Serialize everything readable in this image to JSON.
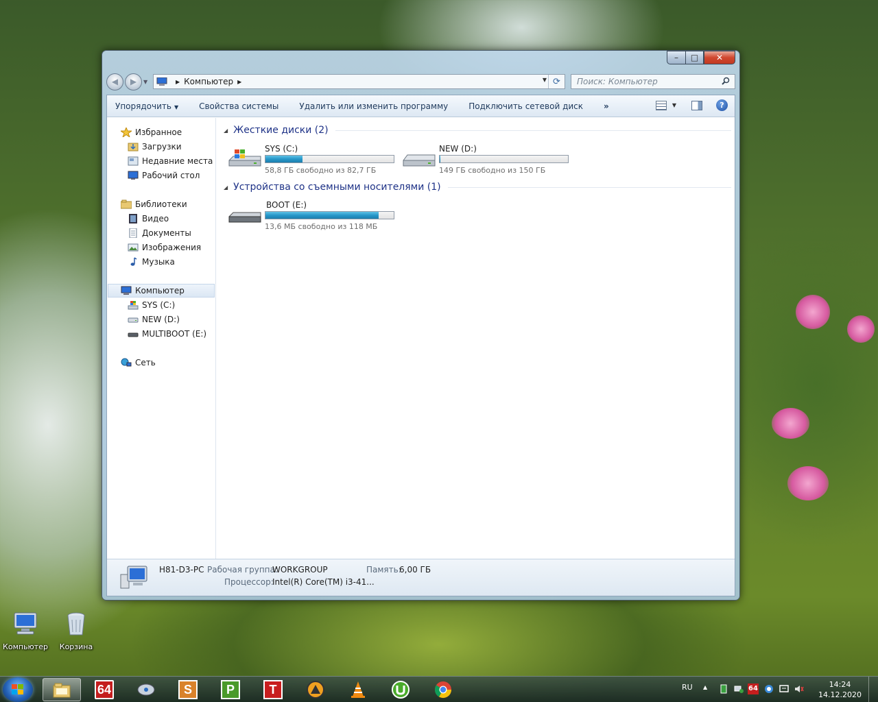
{
  "window": {
    "controls": {
      "minimize": "–",
      "maximize": "□",
      "close": "✕"
    },
    "address": {
      "crumb": "Компьютер"
    },
    "search": {
      "placeholder": "Поиск: Компьютер"
    }
  },
  "commandbar": {
    "items": [
      {
        "label": "Упорядочить",
        "dropdown": true
      },
      {
        "label": "Свойства системы"
      },
      {
        "label": "Удалить или изменить программу"
      },
      {
        "label": "Подключить сетевой диск"
      }
    ],
    "more": "»"
  },
  "navpane": {
    "favorites": {
      "label": "Избранное",
      "items": [
        "Загрузки",
        "Недавние места",
        "Рабочий стол"
      ]
    },
    "libraries": {
      "label": "Библиотеки",
      "items": [
        "Видео",
        "Документы",
        "Изображения",
        "Музыка"
      ]
    },
    "computer": {
      "label": "Компьютер",
      "items": [
        "SYS (C:)",
        "NEW (D:)",
        "MULTIBOOT (E:)"
      ]
    },
    "network": {
      "label": "Сеть"
    }
  },
  "content": {
    "hard_drives": {
      "header": "Жесткие диски (2)",
      "drives": [
        {
          "name": "SYS (C:)",
          "free_text": "58,8 ГБ свободно из 82,7 ГБ",
          "used_fraction": 0.289
        },
        {
          "name": "NEW (D:)",
          "free_text": "149 ГБ свободно из 150 ГБ",
          "used_fraction": 0.007
        }
      ]
    },
    "removable": {
      "header": "Устройства со съемными носителями (1)",
      "drives": [
        {
          "name": "BOOT (E:)",
          "free_text": "13,6 МБ свободно из 118 МБ",
          "used_fraction": 0.885
        }
      ]
    }
  },
  "details": {
    "computer_name": "H81-D3-PC",
    "workgroup_label": "Рабочая группа:",
    "workgroup_value": "WORKGROUP",
    "memory_label": "Память:",
    "memory_value": "6,00 ГБ",
    "cpu_label": "Процессор:",
    "cpu_value": "Intel(R) Core(TM) i3-41..."
  },
  "desktop": {
    "icons": [
      {
        "label": "Компьютер"
      },
      {
        "label": "Корзина"
      }
    ]
  },
  "taskbar": {
    "pinned": [
      {
        "name": "explorer"
      },
      {
        "name": "aida64",
        "text": "64"
      },
      {
        "name": "disk-tool"
      },
      {
        "name": "s-app",
        "text": "S"
      },
      {
        "name": "p-app",
        "text": "P"
      },
      {
        "name": "t-app",
        "text": "T"
      },
      {
        "name": "aimp"
      },
      {
        "name": "vlc"
      },
      {
        "name": "utorrent"
      },
      {
        "name": "chrome"
      }
    ],
    "tray": {
      "language": "RU",
      "tray_up": "▲",
      "aida_badge": "64",
      "time": "14:24",
      "date": "14.12.2020"
    }
  },
  "colors": {
    "accent_bar": "#2798c9",
    "group_header": "#1e3287",
    "close_button": "#c23a22"
  }
}
